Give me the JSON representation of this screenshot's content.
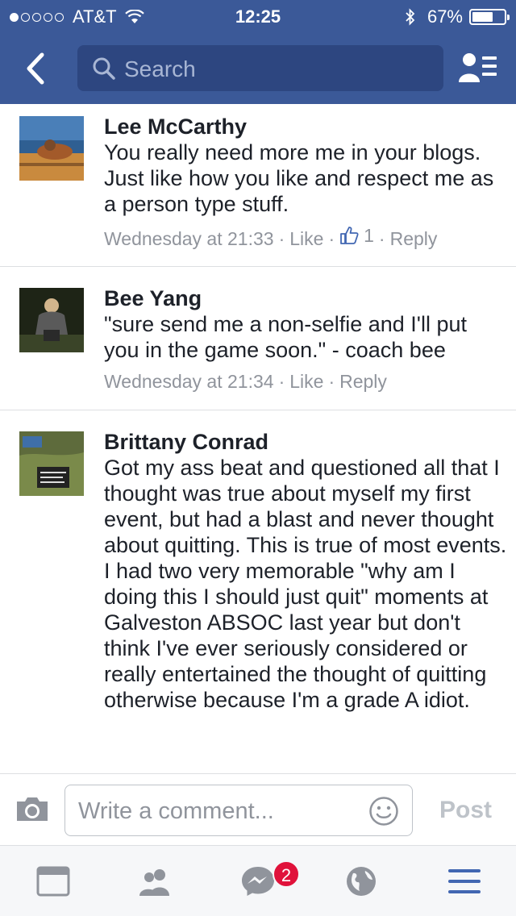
{
  "status_bar": {
    "carrier": "AT&T",
    "time": "12:25",
    "battery": "67%",
    "battery_level": 0.67,
    "signal_dots_filled": 1,
    "signal_dots_total": 5
  },
  "nav": {
    "search_placeholder": "Search"
  },
  "comments": [
    {
      "name": "Lee McCarthy",
      "text": "You really need more me in your blogs. Just like how you like and respect me as a person type stuff.",
      "time": "Wednesday at 21:33",
      "like_label": "Like",
      "like_count": "1",
      "reply_label": "Reply"
    },
    {
      "name": "Bee Yang",
      "text": "\"sure send me a non-selfie and I'll put you in the game soon.\" - coach bee",
      "time": "Wednesday at 21:34",
      "like_label": "Like",
      "reply_label": "Reply"
    },
    {
      "name": "Brittany Conrad",
      "text": "Got my ass beat and questioned all that I thought was true about myself my first event, but had a blast and never thought about quitting.  This is true of most events.  I had two very memorable \"why am I doing this I should just quit\" moments at Galveston ABSOC last year but don't think I've ever seriously considered or really entertained the thought of quitting otherwise because I'm a grade A idiot."
    }
  ],
  "composer": {
    "placeholder": "Write a comment...",
    "post_label": "Post"
  },
  "tabbar": {
    "messenger_badge": "2"
  },
  "colors": {
    "brand": "#3b5998",
    "active_tab": "#4267b2",
    "badge": "#e0123b"
  }
}
